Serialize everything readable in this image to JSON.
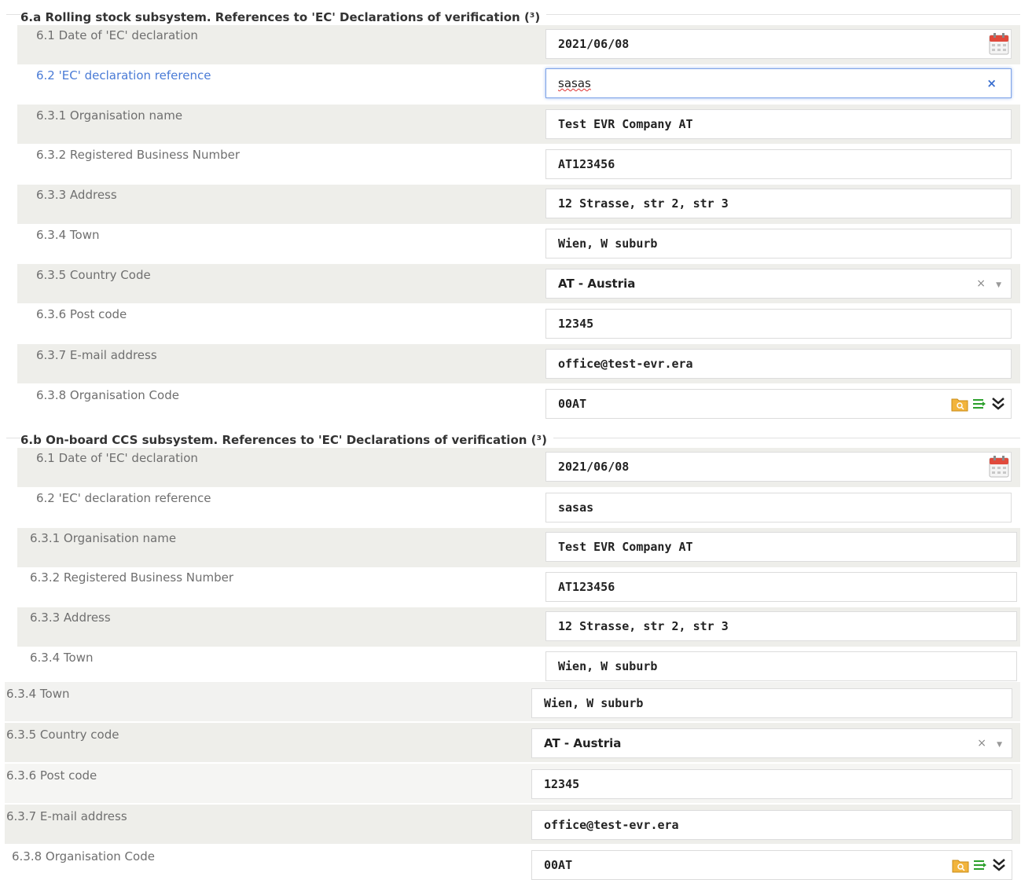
{
  "sections": [
    {
      "legend": "6.a Rolling stock subsystem. References to 'EC' Declarations of verification (³)",
      "fields": {
        "date": {
          "label": "6.1 Date of 'EC' declaration",
          "value": "2021/06/08"
        },
        "reference": {
          "label": "6.2 'EC' declaration reference",
          "value": "sasas"
        },
        "org_name": {
          "label": "6.3.1 Organisation name",
          "value": "Test EVR Company AT"
        },
        "reg_number": {
          "label": "6.3.2 Registered Business Number",
          "value": "AT123456"
        },
        "address": {
          "label": "6.3.3 Address",
          "value": "12 Strasse, str 2, str 3"
        },
        "town": {
          "label": "6.3.4 Town",
          "value": "Wien, W suburb"
        },
        "country": {
          "label": "6.3.5 Country Code",
          "value": "AT - Austria"
        },
        "post_code": {
          "label": "6.3.6 Post code",
          "value": "12345"
        },
        "email": {
          "label": "6.3.7 E-mail address",
          "value": "office@test-evr.era"
        },
        "org_code": {
          "label": "6.3.8 Organisation Code",
          "value": "00AT"
        }
      }
    },
    {
      "legend": "6.b On-board CCS subsystem. References to 'EC' Declarations of verification (³)",
      "fields": {
        "date": {
          "label": "6.1 Date of 'EC' declaration",
          "value": "2021/06/08"
        },
        "reference": {
          "label": "6.2 'EC' declaration reference",
          "value": "sasas"
        },
        "org_name": {
          "label": "6.3.1 Organisation name",
          "value": "Test EVR Company AT"
        },
        "reg_number": {
          "label": "6.3.2 Registered Business Number",
          "value": "AT123456"
        },
        "address": {
          "label": "6.3.3 Address",
          "value": "12 Strasse, str 2, str 3"
        },
        "town": {
          "label": "6.3.4 Town",
          "value": "Wien, W suburb"
        }
      }
    }
  ],
  "lower": {
    "town": {
      "label": "6.3.4 Town",
      "value": "Wien, W suburb"
    },
    "country": {
      "label": "6.3.5 Country code",
      "value": "AT - Austria"
    },
    "post_code": {
      "label": "6.3.6 Post code",
      "value": "12345"
    },
    "email": {
      "label": "6.3.7 E-mail address",
      "value": "office@test-evr.era"
    },
    "org_code": {
      "label": "6.3.8 Organisation Code",
      "value": "00AT"
    }
  },
  "controls": {
    "clear_symbol": "×",
    "select_clear_symbol": "×",
    "select_arrow_symbol": "▼"
  },
  "icons": [
    "calendar-icon",
    "clear-icon",
    "chevron-down-icon",
    "folder-search-icon",
    "list-icon",
    "double-chevron-down-icon"
  ],
  "colors": {
    "focus_label": "#4a7bd6",
    "row_shade": "#eeeeea",
    "focus_border": "#7ea3e8"
  }
}
